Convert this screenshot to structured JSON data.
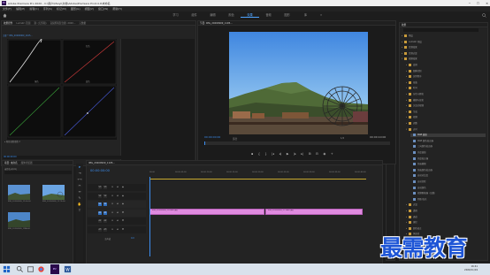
{
  "window": {
    "title": "Adobe Premiere Pro 2020 - C:\\用户\\Iifeiyi\\文档\\Adobe\\Premiere Pro\\14.0\\未命名",
    "app_badge": "Pr"
  },
  "menu": [
    "文件(F)",
    "编辑(E)",
    "剪辑(C)",
    "序列(S)",
    "标记(M)",
    "图形(G)",
    "视图(V)",
    "窗口(W)",
    "帮助(H)"
  ],
  "workspaces": {
    "tabs": [
      "学习",
      "组件",
      "编辑",
      "颜色",
      "效果",
      "音频",
      "图形",
      "库"
    ],
    "active": "效果",
    "more": "»"
  },
  "scopes_panel": {
    "tabs": [
      "效果控件",
      "Lumetri 范围",
      "源: (无剪辑)",
      "音频剪辑混合器: 2020...",
      "元数据"
    ],
    "active_tab": "效果控件",
    "sequence_label": "主要 * IMG_20200909_1105...",
    "labels": [
      "绿色",
      "蓝色",
      "红色"
    ],
    "footer_label": "▸ 映射调整参数 2"
  },
  "program_monitor": {
    "title": "节目: IMG_20200909_1105...",
    "timecode": "00:00:00:00",
    "duration": "00:00:10:00",
    "fit": "适合",
    "quality": "1/2",
    "transport": [
      "▪",
      "{",
      "}",
      "|◂",
      "◂|",
      "▶",
      "|▸",
      "▸|",
      "⊞",
      "⊟",
      "◉",
      "+"
    ]
  },
  "effects_panel": {
    "title": "效果",
    "items": [
      {
        "label": "预设",
        "level": 1,
        "folder": true,
        "open": false
      },
      {
        "label": "Lumetri 预设",
        "level": 1,
        "folder": true,
        "open": false
      },
      {
        "label": "音频效果",
        "level": 1,
        "folder": true,
        "open": false
      },
      {
        "label": "音频过渡",
        "level": 1,
        "folder": true,
        "open": false
      },
      {
        "label": "视频效果",
        "level": 1,
        "folder": true,
        "open": true
      },
      {
        "label": "变换",
        "level": 2,
        "folder": true,
        "open": false
      },
      {
        "label": "图像控制",
        "level": 2,
        "folder": true,
        "open": false
      },
      {
        "label": "实用程序",
        "level": 2,
        "folder": true,
        "open": false
      },
      {
        "label": "扭曲",
        "level": 2,
        "folder": true,
        "open": false
      },
      {
        "label": "时间",
        "level": 2,
        "folder": true,
        "open": false
      },
      {
        "label": "杂色与颗粒",
        "level": 2,
        "folder": true,
        "open": false
      },
      {
        "label": "模糊与锐化",
        "level": 2,
        "folder": true,
        "open": false
      },
      {
        "label": "沉浸式视频",
        "level": 2,
        "folder": true,
        "open": false
      },
      {
        "label": "生成",
        "level": 2,
        "folder": true,
        "open": false
      },
      {
        "label": "视频",
        "level": 2,
        "folder": true,
        "open": false
      },
      {
        "label": "调整",
        "level": 2,
        "folder": true,
        "open": false
      },
      {
        "label": "过时",
        "level": 2,
        "folder": true,
        "open": true
      },
      {
        "label": "RGB 曲线",
        "level": 3,
        "folder": false,
        "selected": true
      },
      {
        "label": "RGB 颜色校正器",
        "level": 3,
        "folder": false
      },
      {
        "label": "三向颜色校正器",
        "level": 3,
        "folder": false
      },
      {
        "label": "亮度曲线",
        "level": 3,
        "folder": false
      },
      {
        "label": "亮度校正器",
        "level": 3,
        "folder": false
      },
      {
        "label": "快速模糊",
        "level": 3,
        "folder": false
      },
      {
        "label": "快速颜色校正器",
        "level": 3,
        "folder": false
      },
      {
        "label": "自动对比度",
        "level": 3,
        "folder": false
      },
      {
        "label": "自动色阶",
        "level": 3,
        "folder": false
      },
      {
        "label": "自动颜色",
        "level": 3,
        "folder": false
      },
      {
        "label": "视频限幅器（旧版）",
        "level": 3,
        "folder": false
      },
      {
        "label": "阴影/高光",
        "level": 3,
        "folder": false
      },
      {
        "label": "过渡",
        "level": 2,
        "folder": true,
        "open": false
      },
      {
        "label": "透视",
        "level": 2,
        "folder": true,
        "open": false
      },
      {
        "label": "通道",
        "level": 2,
        "folder": true,
        "open": false
      },
      {
        "label": "键控",
        "level": 2,
        "folder": true,
        "open": false
      },
      {
        "label": "颜色校正",
        "level": 2,
        "folder": true,
        "open": false
      },
      {
        "label": "风格化",
        "level": 2,
        "folder": true,
        "open": false
      },
      {
        "label": "视频过渡",
        "level": 1,
        "folder": true,
        "open": false
      }
    ]
  },
  "project_panel": {
    "tabs": [
      "项目: 未命名",
      "媒体浏览器"
    ],
    "project_file": "未命名.prproj",
    "clips": [
      {
        "name": "IMG_20200909_110...",
        "dur": "5:00"
      },
      {
        "name": "IMG_20200909_117...",
        "dur": "5:00"
      },
      {
        "name": "IMG_20200909_110...",
        "dur": "10:00"
      }
    ]
  },
  "timeline": {
    "title": "IMG_20200909_1105...",
    "timecode": "00:00:00:00",
    "ruler": [
      "00:00",
      "00:00:05:00",
      "00:00:10:00",
      "00:00:15:00",
      "00:00:20:00",
      "00:00:25:00",
      "00:00:30:00",
      "00:00:35:00",
      "00:00:40:00"
    ],
    "tracks": [
      "V3",
      "V2",
      "V1",
      "A1",
      "A2",
      "A3"
    ],
    "master": "主声道",
    "master_value": "0.0",
    "clips": [
      {
        "name": "IMG_20200909_110940.jpg"
      },
      {
        "name": "IMG_20200909_171445.jpg"
      }
    ]
  },
  "taskbar": {
    "time": "16:41",
    "date": "2020/11/19"
  },
  "watermark": "最需教育",
  "colors": {
    "accent": "#4fa4ff",
    "clip": "#e08be0",
    "timecode": "#3c8ef0"
  }
}
